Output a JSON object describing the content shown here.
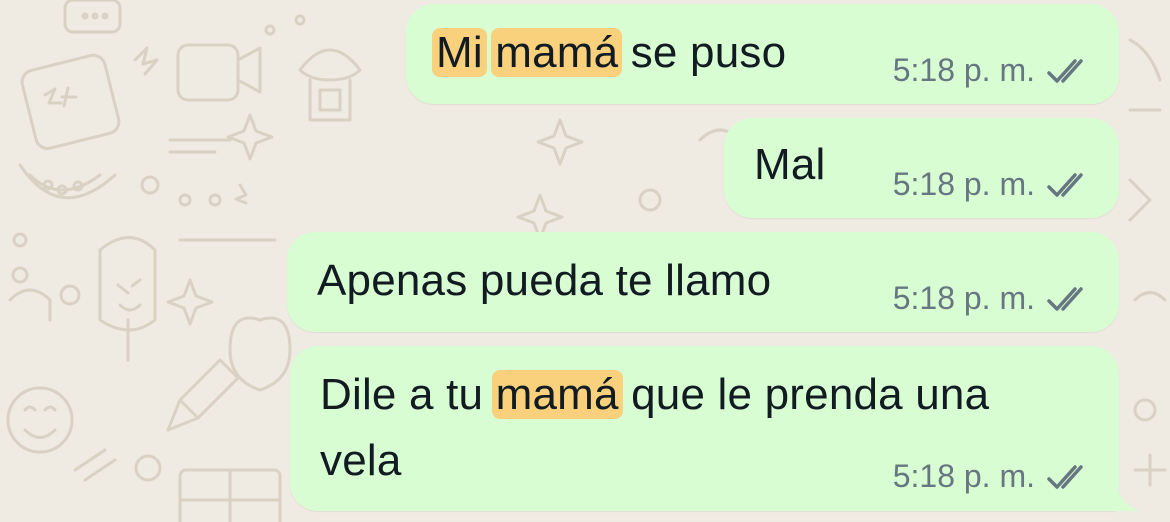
{
  "chat": {
    "messages": [
      {
        "segments": [
          {
            "text": "Mi",
            "highlight": true
          },
          {
            "text": " ",
            "highlight": false
          },
          {
            "text": "mamá",
            "highlight": true
          },
          {
            "text": " se puso",
            "highlight": false
          }
        ],
        "time": "5:18 p. m.",
        "status": "read"
      },
      {
        "segments": [
          {
            "text": "Mal",
            "highlight": false
          }
        ],
        "time": "5:18 p. m.",
        "status": "read"
      },
      {
        "segments": [
          {
            "text": "Apenas pueda te llamo",
            "highlight": false
          }
        ],
        "time": "5:18 p. m.",
        "status": "read"
      },
      {
        "line1": [
          {
            "text": "Dile a tu ",
            "highlight": false
          },
          {
            "text": "mamá",
            "highlight": true
          },
          {
            "text": " que le prenda una",
            "highlight": false
          }
        ],
        "line2": "vela",
        "time": "5:18 p. m.",
        "status": "read"
      }
    ]
  },
  "colors": {
    "background": "#efeae2",
    "outgoing_bubble": "#d9fdd3",
    "search_highlight": "#f9d17d",
    "timestamp": "#667781",
    "read_ticks": "#667781"
  },
  "icons": {
    "status": "double-check-icon"
  }
}
